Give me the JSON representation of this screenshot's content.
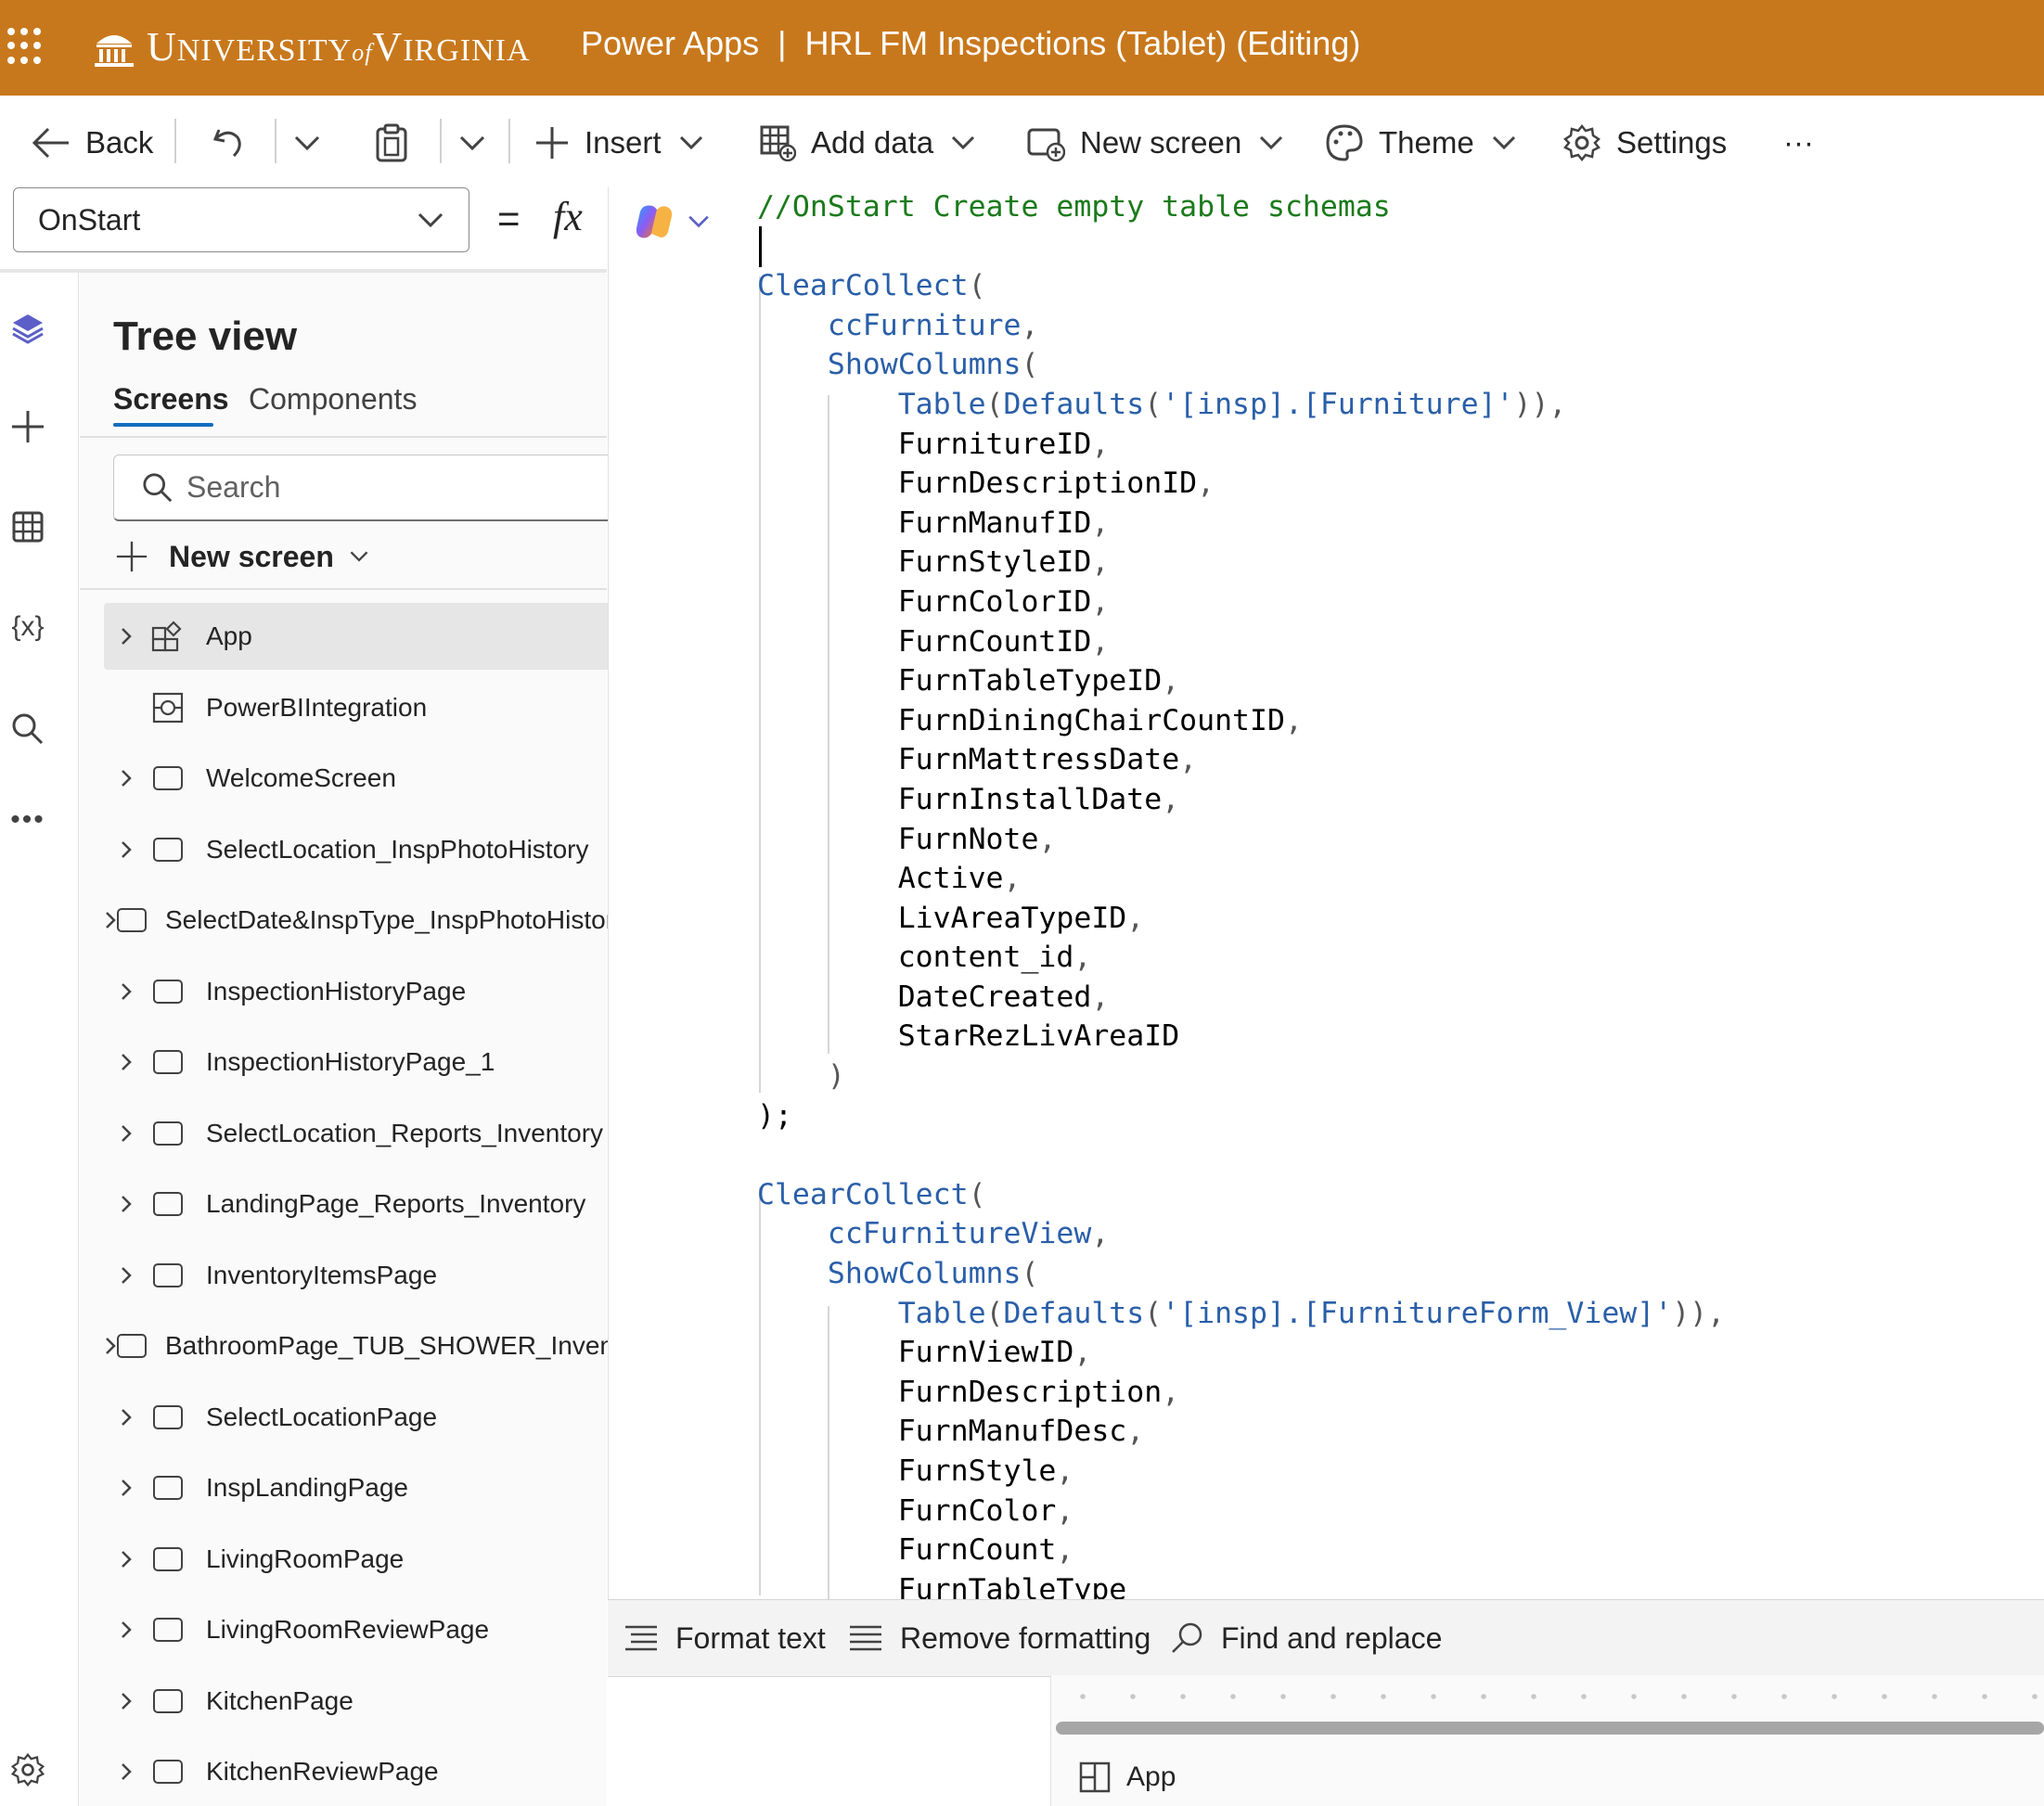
{
  "titlebar": {
    "org_name": "University of Virginia",
    "org_logo_text": "UNIVERSITY of VIRGINIA",
    "title": "Power Apps  |  HRL FM Inspections (Tablet) (Editing)"
  },
  "commandbar": {
    "back": "Back",
    "insert": "Insert",
    "add_data": "Add data",
    "new_screen": "New screen",
    "theme": "Theme",
    "settings": "Settings",
    "more": "···"
  },
  "formula_bar": {
    "property": "OnStart",
    "equals": "=",
    "fx": "fx"
  },
  "tree_view": {
    "title": "Tree view",
    "tabs": [
      "Screens",
      "Components"
    ],
    "search_placeholder": "Search",
    "new_screen": "New screen",
    "items": [
      {
        "label": "App",
        "expandable": true,
        "selected": true,
        "icon": "app-icon"
      },
      {
        "label": "PowerBIIntegration",
        "expandable": false,
        "selected": false,
        "icon": "powerbi-integration-icon"
      },
      {
        "label": "WelcomeScreen",
        "expandable": true,
        "selected": false,
        "icon": "screen-icon"
      },
      {
        "label": "SelectLocation_InspPhotoHistory",
        "expandable": true,
        "selected": false,
        "icon": "screen-icon"
      },
      {
        "label": "SelectDate&InspType_InspPhotoHistory",
        "expandable": true,
        "selected": false,
        "icon": "screen-icon"
      },
      {
        "label": "InspectionHistoryPage",
        "expandable": true,
        "selected": false,
        "icon": "screen-icon"
      },
      {
        "label": "InspectionHistoryPage_1",
        "expandable": true,
        "selected": false,
        "icon": "screen-icon"
      },
      {
        "label": "SelectLocation_Reports_Inventory",
        "expandable": true,
        "selected": false,
        "icon": "screen-icon"
      },
      {
        "label": "LandingPage_Reports_Inventory",
        "expandable": true,
        "selected": false,
        "icon": "screen-icon"
      },
      {
        "label": "InventoryItemsPage",
        "expandable": true,
        "selected": false,
        "icon": "screen-icon"
      },
      {
        "label": "BathroomPage_TUB_SHOWER_Inventory",
        "expandable": true,
        "selected": false,
        "icon": "screen-icon"
      },
      {
        "label": "SelectLocationPage",
        "expandable": true,
        "selected": false,
        "icon": "screen-icon"
      },
      {
        "label": "InspLandingPage",
        "expandable": true,
        "selected": false,
        "icon": "screen-icon"
      },
      {
        "label": "LivingRoomPage",
        "expandable": true,
        "selected": false,
        "icon": "screen-icon"
      },
      {
        "label": "LivingRoomReviewPage",
        "expandable": true,
        "selected": false,
        "icon": "screen-icon"
      },
      {
        "label": "KitchenPage",
        "expandable": true,
        "selected": false,
        "icon": "screen-icon"
      },
      {
        "label": "KitchenReviewPage",
        "expandable": true,
        "selected": false,
        "icon": "screen-icon"
      }
    ]
  },
  "editor": {
    "lines": [
      {
        "indent": 0,
        "tokens": [
          [
            "cm",
            "//OnStart Create empty table schemas"
          ]
        ]
      },
      {
        "indent": 0,
        "tokens": []
      },
      {
        "indent": 0,
        "tokens": [
          [
            "fn",
            "ClearCollect"
          ],
          [
            "pn",
            "("
          ]
        ]
      },
      {
        "indent": 1,
        "tokens": [
          [
            "vr",
            "ccFurniture"
          ],
          [
            "pn",
            ","
          ]
        ]
      },
      {
        "indent": 1,
        "tokens": [
          [
            "fn",
            "ShowColumns"
          ],
          [
            "pn",
            "("
          ]
        ]
      },
      {
        "indent": 2,
        "tokens": [
          [
            "fn",
            "Table"
          ],
          [
            "pn",
            "("
          ],
          [
            "fn",
            "Defaults"
          ],
          [
            "pn",
            "("
          ],
          [
            "st",
            "'[insp].[Furniture]'"
          ],
          [
            "pn",
            ")),"
          ]
        ]
      },
      {
        "indent": 2,
        "tokens": [
          [
            "tx",
            "FurnitureID"
          ],
          [
            "pn",
            ","
          ]
        ]
      },
      {
        "indent": 2,
        "tokens": [
          [
            "tx",
            "FurnDescriptionID"
          ],
          [
            "pn",
            ","
          ]
        ]
      },
      {
        "indent": 2,
        "tokens": [
          [
            "tx",
            "FurnManufID"
          ],
          [
            "pn",
            ","
          ]
        ]
      },
      {
        "indent": 2,
        "tokens": [
          [
            "tx",
            "FurnStyleID"
          ],
          [
            "pn",
            ","
          ]
        ]
      },
      {
        "indent": 2,
        "tokens": [
          [
            "tx",
            "FurnColorID"
          ],
          [
            "pn",
            ","
          ]
        ]
      },
      {
        "indent": 2,
        "tokens": [
          [
            "tx",
            "FurnCountID"
          ],
          [
            "pn",
            ","
          ]
        ]
      },
      {
        "indent": 2,
        "tokens": [
          [
            "tx",
            "FurnTableTypeID"
          ],
          [
            "pn",
            ","
          ]
        ]
      },
      {
        "indent": 2,
        "tokens": [
          [
            "tx",
            "FurnDiningChairCountID"
          ],
          [
            "pn",
            ","
          ]
        ]
      },
      {
        "indent": 2,
        "tokens": [
          [
            "tx",
            "FurnMattressDate"
          ],
          [
            "pn",
            ","
          ]
        ]
      },
      {
        "indent": 2,
        "tokens": [
          [
            "tx",
            "FurnInstallDate"
          ],
          [
            "pn",
            ","
          ]
        ]
      },
      {
        "indent": 2,
        "tokens": [
          [
            "tx",
            "FurnNote"
          ],
          [
            "pn",
            ","
          ]
        ]
      },
      {
        "indent": 2,
        "tokens": [
          [
            "tx",
            "Active"
          ],
          [
            "pn",
            ","
          ]
        ]
      },
      {
        "indent": 2,
        "tokens": [
          [
            "tx",
            "LivAreaTypeID"
          ],
          [
            "pn",
            ","
          ]
        ]
      },
      {
        "indent": 2,
        "tokens": [
          [
            "tx",
            "content_id"
          ],
          [
            "pn",
            ","
          ]
        ]
      },
      {
        "indent": 2,
        "tokens": [
          [
            "tx",
            "DateCreated"
          ],
          [
            "pn",
            ","
          ]
        ]
      },
      {
        "indent": 2,
        "tokens": [
          [
            "tx",
            "StarRezLivAreaID"
          ]
        ]
      },
      {
        "indent": 1,
        "tokens": [
          [
            "pn",
            ")"
          ]
        ]
      },
      {
        "indent": 0,
        "tokens": [
          [
            "tx",
            ");"
          ]
        ]
      },
      {
        "indent": 0,
        "tokens": []
      },
      {
        "indent": 0,
        "tokens": [
          [
            "fn",
            "ClearCollect"
          ],
          [
            "pn",
            "("
          ]
        ]
      },
      {
        "indent": 1,
        "tokens": [
          [
            "vr",
            "ccFurnitureView"
          ],
          [
            "pn",
            ","
          ]
        ]
      },
      {
        "indent": 1,
        "tokens": [
          [
            "fn",
            "ShowColumns"
          ],
          [
            "pn",
            "("
          ]
        ]
      },
      {
        "indent": 2,
        "tokens": [
          [
            "fn",
            "Table"
          ],
          [
            "pn",
            "("
          ],
          [
            "fn",
            "Defaults"
          ],
          [
            "pn",
            "("
          ],
          [
            "st",
            "'[insp].[FurnitureForm_View]'"
          ],
          [
            "pn",
            ")),"
          ]
        ]
      },
      {
        "indent": 2,
        "tokens": [
          [
            "tx",
            "FurnViewID"
          ],
          [
            "pn",
            ","
          ]
        ]
      },
      {
        "indent": 2,
        "tokens": [
          [
            "tx",
            "FurnDescription"
          ],
          [
            "pn",
            ","
          ]
        ]
      },
      {
        "indent": 2,
        "tokens": [
          [
            "tx",
            "FurnManufDesc"
          ],
          [
            "pn",
            ","
          ]
        ]
      },
      {
        "indent": 2,
        "tokens": [
          [
            "tx",
            "FurnStyle"
          ],
          [
            "pn",
            ","
          ]
        ]
      },
      {
        "indent": 2,
        "tokens": [
          [
            "tx",
            "FurnColor"
          ],
          [
            "pn",
            ","
          ]
        ]
      },
      {
        "indent": 2,
        "tokens": [
          [
            "tx",
            "FurnCount"
          ],
          [
            "pn",
            ","
          ]
        ]
      },
      {
        "indent": 2,
        "tokens": [
          [
            "tx",
            "FurnTableType"
          ]
        ]
      }
    ]
  },
  "editor_footer": {
    "format_text": "Format text",
    "remove_formatting": "Remove formatting",
    "find_replace": "Find and replace"
  },
  "canvas": {
    "selected_label": "App"
  },
  "colors": {
    "brand": "#c8781c",
    "accent": "#0f6cbd",
    "code_comment": "#1b7a1b",
    "code_function": "#2a5fa8"
  }
}
